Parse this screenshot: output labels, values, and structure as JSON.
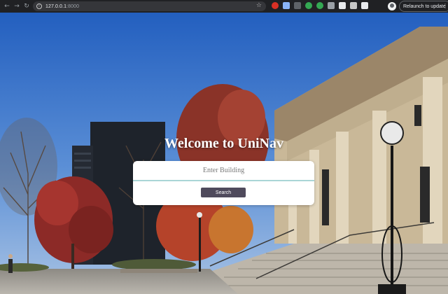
{
  "browser": {
    "url_host": "127.0.0.1",
    "url_port": ":8000",
    "relaunch_label": "Relaunch to update",
    "extension_colors": [
      "#d93025",
      "#8ab4f8",
      "#5f6368",
      "#34a853",
      "#34a853",
      "#f28b82",
      "#e8eaed",
      "#e8eaed",
      "#e8eaed"
    ]
  },
  "page": {
    "title": "Welcome to UniNav",
    "search": {
      "placeholder": "Enter Building",
      "value": "",
      "button_label": "Search"
    }
  },
  "colors": {
    "sky": "#2f6fc6",
    "button": "#4f4a5c",
    "input_underline": "#a9d5d6",
    "chrome": "#202124"
  }
}
